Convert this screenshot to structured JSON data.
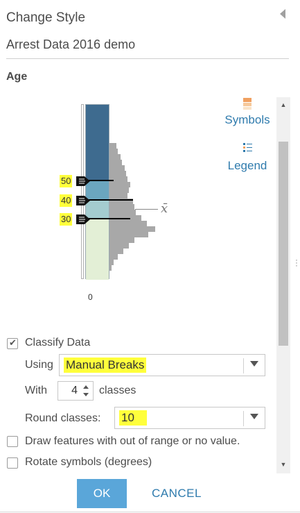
{
  "panel": {
    "title": "Change Style",
    "layer_name": "Arrest Data 2016 demo",
    "field_name": "Age",
    "collapse_icon": "triangle-left-icon"
  },
  "histogram": {
    "break_labels": [
      "50",
      "40",
      "30"
    ],
    "min_label": "0",
    "mean_symbol": "x̄",
    "class_colors": [
      "#3e6b8f",
      "#6ba6bf",
      "#a4cccf",
      "#e3efd6"
    ],
    "handle_icon": "slider-handle-icon"
  },
  "side_links": {
    "symbols_label": "Symbols",
    "symbols_icon": "symbols-icon",
    "legend_label": "Legend",
    "legend_icon": "legend-icon"
  },
  "classify": {
    "checkbox_label": "Classify Data",
    "checked": true,
    "using_label": "Using",
    "method_value": "Manual Breaks",
    "with_label": "With",
    "classes_count": "4",
    "classes_label": "classes",
    "round_label": "Round classes:",
    "round_value": "10"
  },
  "options": {
    "out_of_range_label": "Draw features with out of range or no value.",
    "rotate_label": "Rotate symbols (degrees)"
  },
  "buttons": {
    "ok_label": "OK",
    "cancel_label": "CANCEL"
  },
  "colors": {
    "accent": "#2f7bad",
    "ok_button": "#5aa6d9",
    "highlight": "#ffff3c"
  }
}
